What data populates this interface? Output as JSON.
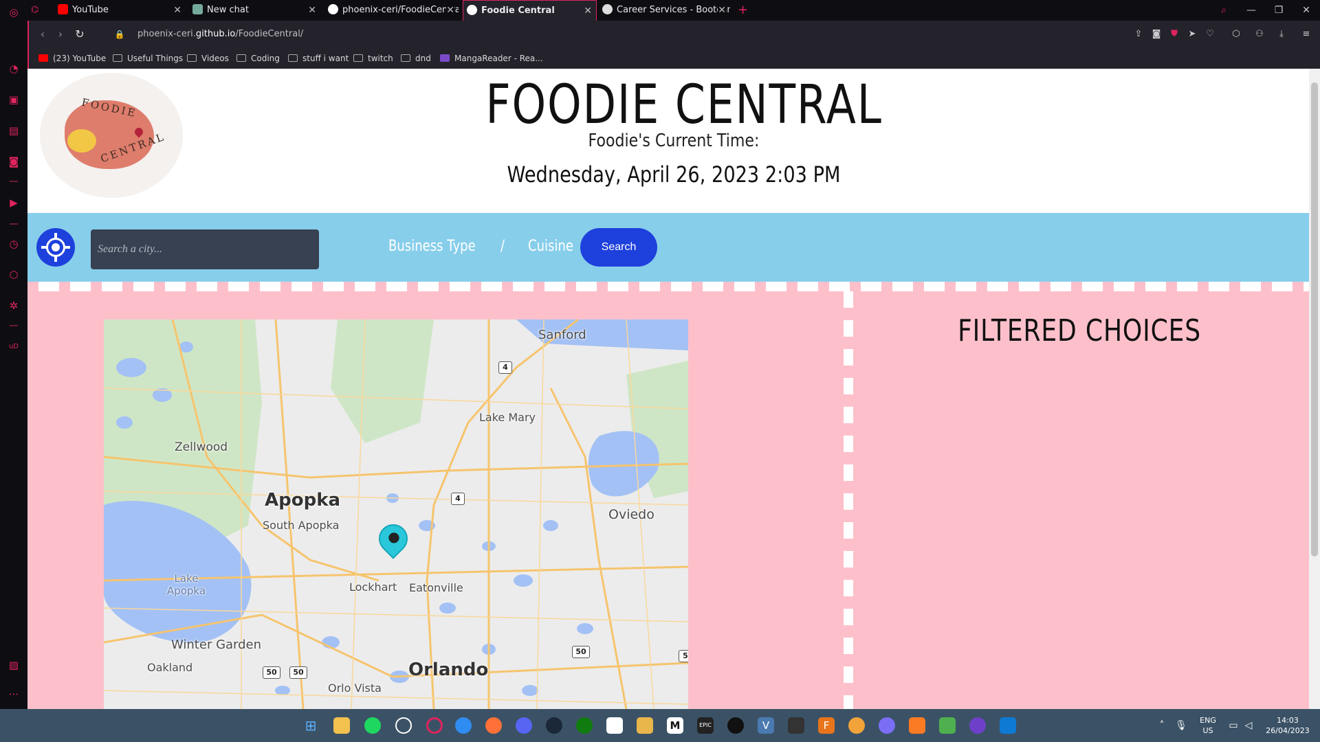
{
  "browser": {
    "tabs": [
      {
        "label": "YouTube",
        "icon": "youtube-icon"
      },
      {
        "label": "New chat",
        "icon": "chatgpt-icon"
      },
      {
        "label": "phoenix-ceri/FoodieCentral",
        "icon": "github-icon"
      },
      {
        "label": "Foodie Central",
        "icon": "globe-icon"
      },
      {
        "label": "Career Services - Bootcamp",
        "icon": "globe-icon"
      }
    ],
    "url_host": "phoenix-ceri.",
    "url_domain": "github.io",
    "url_path": "/FoodieCentral/",
    "bookmarks": [
      {
        "label": "(23) YouTube"
      },
      {
        "label": "Useful Things"
      },
      {
        "label": "Videos"
      },
      {
        "label": "Coding"
      },
      {
        "label": "stuff i want"
      },
      {
        "label": "twitch"
      },
      {
        "label": "dnd"
      },
      {
        "label": "MangaReader - Rea..."
      }
    ]
  },
  "page": {
    "title": "FOODIE CENTRAL",
    "time_label": "Foodie's Current Time:",
    "time_value": "Wednesday, April 26, 2023 2:03 PM",
    "logo_text_top": "FOODIE",
    "logo_text_bottom": "CENTRAL",
    "search": {
      "placeholder": "Search a city...",
      "business_type": "Business Type",
      "separator": "/",
      "cuisine": "Cuisine",
      "button": "Search"
    },
    "filtered_heading": "FILTERED CHOICES",
    "map": {
      "labels": {
        "sanford": "Sanford",
        "lake_mary": "Lake Mary",
        "zellwood": "Zellwood",
        "apopka": "Apopka",
        "south_apopka": "South Apopka",
        "oviedo": "Oviedo",
        "lake_apopka": "Lake Apopka",
        "lockhart": "Lockhart",
        "eatonville": "Eatonville",
        "winter_garden": "Winter Garden",
        "oakland": "Oakland",
        "orlando": "Orlando",
        "orlo_vista": "Orlo Vista"
      },
      "shields": {
        "i4_north": "4",
        "i4_mid": "4",
        "sr50_a": "50",
        "sr50_b": "50",
        "sr50_c": "50",
        "edge": "5"
      }
    }
  },
  "taskbar": {
    "lang_top": "ENG",
    "lang_bottom": "US",
    "time": "14:03",
    "date": "26/04/2023"
  },
  "colors": {
    "accent": "#e0245e",
    "search_band": "#87ceeb",
    "content_bg": "#fdc0cb",
    "button_blue": "#1e40dc"
  }
}
